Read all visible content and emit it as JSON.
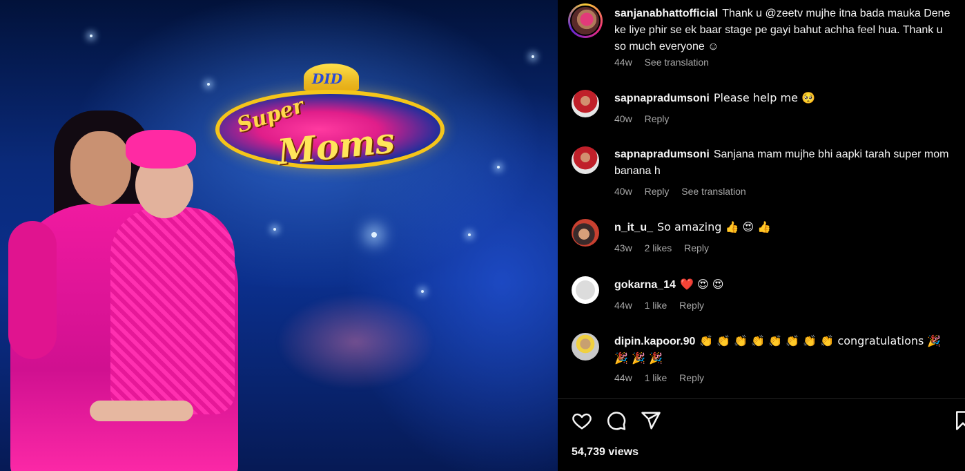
{
  "post": {
    "author": "sanjanabhattofficial",
    "caption": "Thank u @zeetv mujhe itna bada mauka Dene ke liye phir se ek baar stage pe gayi bahut achha feel hua. Thank u so much everyone ☺",
    "age": "44w",
    "see_translation": "See translation"
  },
  "media": {
    "logo_small": "DID",
    "logo_word1": "Super",
    "logo_word2": "Moms"
  },
  "comments": [
    {
      "user": "sapnapradumsoni",
      "text": "Please help me 🥺",
      "age": "40w",
      "likes": "",
      "reply": "Reply",
      "see_translation": ""
    },
    {
      "user": "sapnapradumsoni",
      "text": "Sanjana mam mujhe bhi aapki tarah super mom banana h",
      "age": "40w",
      "likes": "",
      "reply": "Reply",
      "see_translation": "See translation"
    },
    {
      "user": "n_it_u_",
      "text": "So amazing 👍 😍 👍",
      "age": "43w",
      "likes": "2 likes",
      "reply": "Reply",
      "see_translation": ""
    },
    {
      "user": "gokarna_14",
      "text": "❤️ 😍 😍",
      "age": "44w",
      "likes": "1 like",
      "reply": "Reply",
      "see_translation": ""
    },
    {
      "user": "dipin.kapoor.90",
      "text": "👏 👏 👏 👏 👏 👏 👏 👏 congratulations 🎉 🎉 🎉 🎉",
      "age": "44w",
      "likes": "1 like",
      "reply": "Reply",
      "see_translation": ""
    }
  ],
  "icons": {
    "like": "heart-icon",
    "comment": "comment-icon",
    "share": "send-icon",
    "save": "bookmark-icon"
  },
  "stats": {
    "views": "54,739 views"
  }
}
